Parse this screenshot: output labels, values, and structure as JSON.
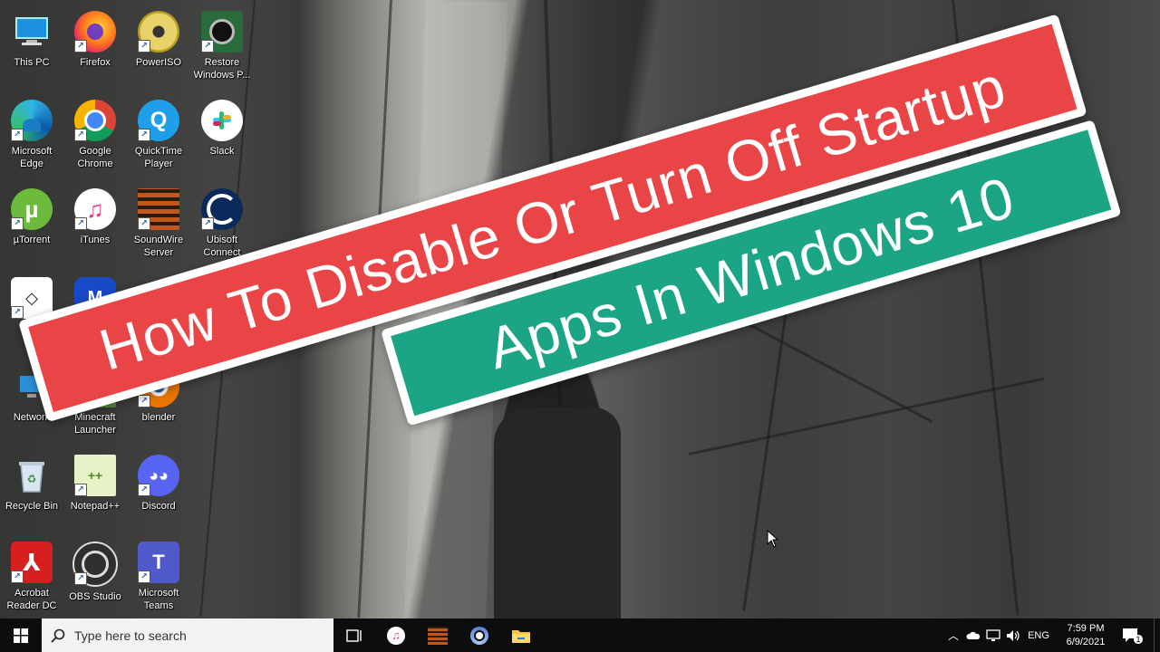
{
  "desktop": {
    "icons": [
      {
        "id": "this-pc",
        "label": "This PC"
      },
      {
        "id": "firefox",
        "label": "Firefox"
      },
      {
        "id": "poweriso",
        "label": "PowerISO"
      },
      {
        "id": "restore",
        "label": "Restore\nWindows P..."
      },
      {
        "id": "edge",
        "label": "Microsoft\nEdge"
      },
      {
        "id": "chrome",
        "label": "Google\nChrome"
      },
      {
        "id": "quicktime",
        "label": "QuickTime\nPlayer"
      },
      {
        "id": "slack",
        "label": "Slack"
      },
      {
        "id": "utorrent",
        "label": "µTorrent"
      },
      {
        "id": "itunes",
        "label": "iTunes"
      },
      {
        "id": "soundwire",
        "label": "SoundWire\nServer"
      },
      {
        "id": "ubisoft",
        "label": "Ubisoft\nConnect"
      },
      {
        "id": "unity",
        "label": ""
      },
      {
        "id": "malwarebytes",
        "label": ""
      },
      {
        "id": "network",
        "label": "Network"
      },
      {
        "id": "minecraft",
        "label": "Minecraft\nLauncher"
      },
      {
        "id": "blender",
        "label": "blender"
      },
      {
        "id": "recycle",
        "label": "Recycle Bin"
      },
      {
        "id": "notepadpp",
        "label": "Notepad++"
      },
      {
        "id": "discord",
        "label": "Discord"
      },
      {
        "id": "acrobat",
        "label": "Acrobat\nReader DC"
      },
      {
        "id": "obs",
        "label": "OBS Studio"
      },
      {
        "id": "teams",
        "label": "Microsoft\nTeams"
      }
    ]
  },
  "banners": {
    "line1": "How To Disable Or Turn Off Startup",
    "line2": "Apps In Windows 10",
    "colors": {
      "red": "#e94446",
      "green": "#1ba585"
    }
  },
  "taskbar": {
    "search_placeholder": "Type here to search",
    "pinned": [
      "task-view",
      "itunes",
      "soundwire",
      "chrome-beta",
      "file-explorer"
    ],
    "tray": {
      "language": "ENG",
      "time": "7:59 PM",
      "date": "6/9/2021",
      "notification_count": "1"
    }
  }
}
